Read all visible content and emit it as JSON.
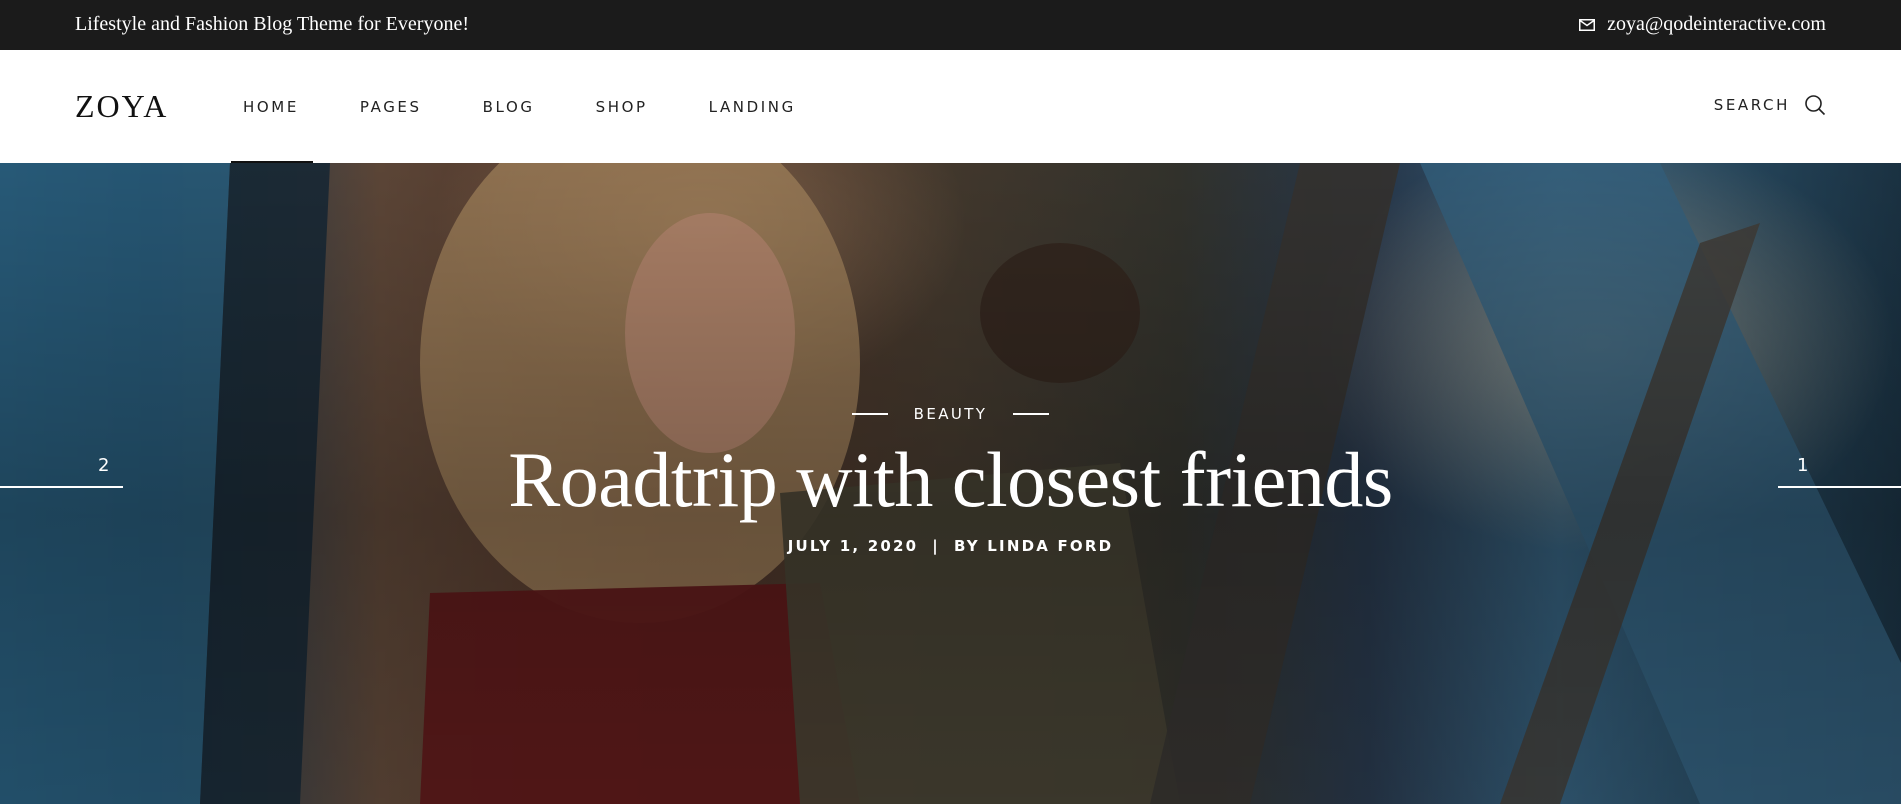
{
  "topbar": {
    "tagline": "Lifestyle and Fashion Blog Theme for Everyone!",
    "email": "zoya@qodeinteractive.com",
    "email_icon": "mail-icon"
  },
  "header": {
    "logo": "ZOYA",
    "nav": [
      {
        "label": "HOME",
        "active": true
      },
      {
        "label": "PAGES",
        "active": false
      },
      {
        "label": "BLOG",
        "active": false
      },
      {
        "label": "SHOP",
        "active": false
      },
      {
        "label": "LANDING",
        "active": false
      }
    ],
    "search_label": "SEARCH",
    "search_icon": "search-icon"
  },
  "hero": {
    "category": "BEAUTY",
    "title": "Roadtrip with closest friends",
    "date": "JULY 1, 2020",
    "separator": "|",
    "author": "BY LINDA FORD",
    "prev_slide": "2",
    "next_slide": "1"
  }
}
